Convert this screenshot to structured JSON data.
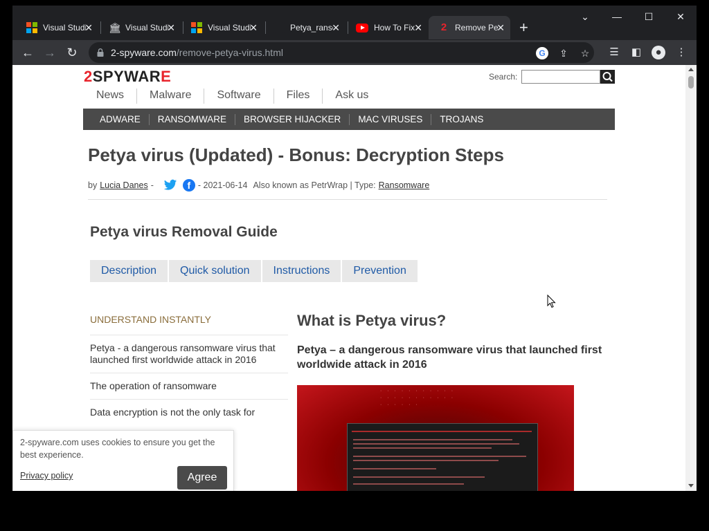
{
  "browser": {
    "tabs": [
      {
        "title": "Visual Studio",
        "favicon": "microsoft-icon"
      },
      {
        "title": "Visual Studio",
        "favicon": "library-icon"
      },
      {
        "title": "Visual Studio",
        "favicon": "microsoft-icon"
      },
      {
        "title": "Petya_ransomware",
        "favicon": "dark-icon"
      },
      {
        "title": "How To Fix",
        "favicon": "youtube-icon"
      },
      {
        "title": "Remove Petya",
        "favicon": "2spyware-icon",
        "active": true
      }
    ],
    "address": {
      "host": "2-spyware.com",
      "path": "/remove-petya-virus.html"
    }
  },
  "site": {
    "logo": {
      "two": "2",
      "text": "SPYWAR",
      "e": "E"
    },
    "search_label": "Search:",
    "search_value": "",
    "nav": [
      "News",
      "Malware",
      "Software",
      "Files",
      "Ask us"
    ],
    "categories": [
      "ADWARE",
      "RANSOMWARE",
      "BROWSER HIJACKER",
      "MAC VIRUSES",
      "TROJANS"
    ]
  },
  "article": {
    "title": "Petya virus (Updated) - Bonus: Decryption Steps",
    "by": "by",
    "author": "Lucia Danes",
    "dash": "-",
    "date": "- 2021-06-14",
    "aka": "Also known as PetrWrap | Type:",
    "type": "Ransomware",
    "guide_title": "Petya virus Removal Guide",
    "guide_tabs": [
      "Description",
      "Quick solution",
      "Instructions",
      "Prevention"
    ],
    "understand": "UNDERSTAND INSTANTLY",
    "sidebar_items": [
      "Petya - a dangerous ransomware virus that launched first worldwide attack in 2016",
      "The operation of ransomware",
      "Data encryption is not the only task for"
    ],
    "section_title": "What is Petya virus?",
    "section_subtitle": "Petya – a dangerous ransomware virus that launched first worldwide attack in 2016"
  },
  "cookie": {
    "message": "2-spyware.com uses cookies to ensure you get the best experience.",
    "policy": "Privacy policy",
    "agree": "Agree"
  },
  "colors": {
    "brand_red": "#e8242c",
    "nav_dark": "#4a4a4a",
    "tab_link": "#1f5aa6"
  }
}
